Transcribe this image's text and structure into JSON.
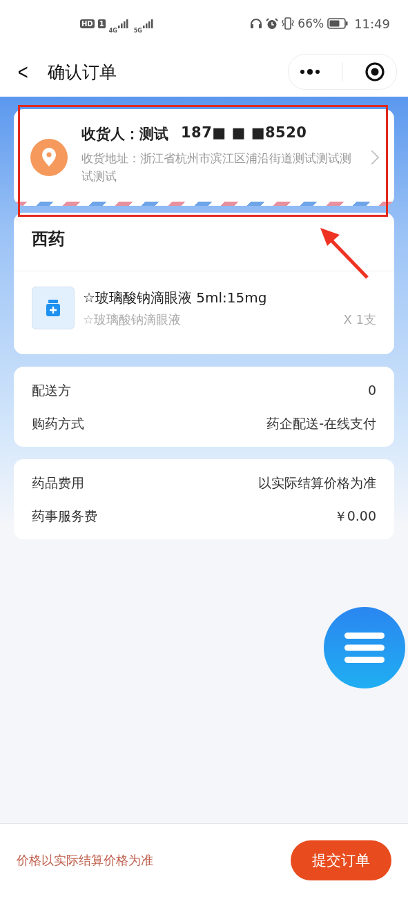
{
  "status_bar": {
    "hd": "HD",
    "sim": "1",
    "net_1": "4G",
    "net_2": "5G",
    "battery": "66%",
    "time": "11:49"
  },
  "nav": {
    "back": "<",
    "title": "确认订单"
  },
  "address": {
    "recipient": "收货人：测试",
    "phone": "187■ ■ ■8520",
    "address": "收货地址：浙江省杭州市滨江区浦沿街道测试测试测试测试"
  },
  "order": {
    "title": "西药",
    "items": [
      {
        "name": "☆玻璃酸钠滴眼液  5ml:15mg",
        "subtitle": "☆玻璃酸钠滴眼液",
        "quantity": "X 1支"
      }
    ]
  },
  "delivery": [
    {
      "label": "配送方",
      "value": "0"
    },
    {
      "label": "购药方式",
      "value": "药企配送-在线支付"
    }
  ],
  "fees": [
    {
      "label": "药品费用",
      "value": "以实际结算价格为准"
    },
    {
      "label": "药事服务费",
      "value": "￥0.00"
    }
  ],
  "footer": {
    "note": "价格以实际结算价格为准",
    "submit": "提交订单"
  }
}
